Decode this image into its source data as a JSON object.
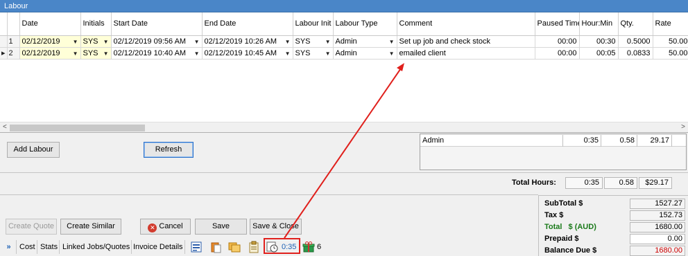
{
  "window": {
    "title": "Labour"
  },
  "grid": {
    "columns": [
      "",
      "Date",
      "Initials",
      "Start Date",
      "End Date",
      "Labour Init",
      "Labour Type",
      "Comment",
      "Paused Time",
      "Hour:Min",
      "Qty.",
      "Rate"
    ],
    "rows": [
      {
        "num": "1",
        "date": "02/12/2019",
        "initials": "SYS",
        "start": "02/12/2019 09:56 AM",
        "end": "02/12/2019 10:26 AM",
        "labour_init": "SYS",
        "labour_type": "Admin",
        "comment": "Set up job and check stock",
        "paused": "00:00",
        "hourmin": "00:30",
        "qty": "0.5000",
        "rate": "50.00"
      },
      {
        "num": "2",
        "date": "02/12/2019",
        "initials": "SYS",
        "start": "02/12/2019 10:40 AM",
        "end": "02/12/2019 10:45 AM",
        "labour_init": "SYS",
        "labour_type": "Admin",
        "comment": "emailed client",
        "paused": "00:00",
        "hourmin": "00:05",
        "qty": "0.0833",
        "rate": "50.00"
      }
    ]
  },
  "buttons": {
    "add_labour": "Add Labour",
    "refresh": "Refresh",
    "create_quote": "Create Quote",
    "create_similar": "Create Similar",
    "cancel": "Cancel",
    "save": "Save",
    "save_close": "Save & Close"
  },
  "summary": {
    "type": "Admin",
    "time": "0:35",
    "hours": "0.58",
    "amount": "29.17"
  },
  "totals": {
    "label": "Total Hours:",
    "time": "0:35",
    "hours": "0.58",
    "amount": "$29.17"
  },
  "financials": {
    "subtotal_label": "SubTotal $",
    "subtotal": "1527.27",
    "tax_label": "Tax $",
    "tax": "152.73",
    "total_label": "Total",
    "total_currency": "$ (AUD)",
    "total": "1680.00",
    "prepaid_label": "Prepaid $",
    "prepaid": "0.00",
    "balance_label": "Balance Due $",
    "balance": "1680.00"
  },
  "tabs": {
    "expand": "»",
    "cost": "Cost",
    "stats": "Stats",
    "linked": "Linked Jobs/Quotes",
    "invoice": "Invoice Details",
    "labour_time": "0:35",
    "gift_count": "6"
  },
  "colors": {
    "title_bar": "#4a86c8",
    "annotation": "#e0201c",
    "total_green": "#1a7a1a",
    "balance_red": "#cc0000"
  }
}
